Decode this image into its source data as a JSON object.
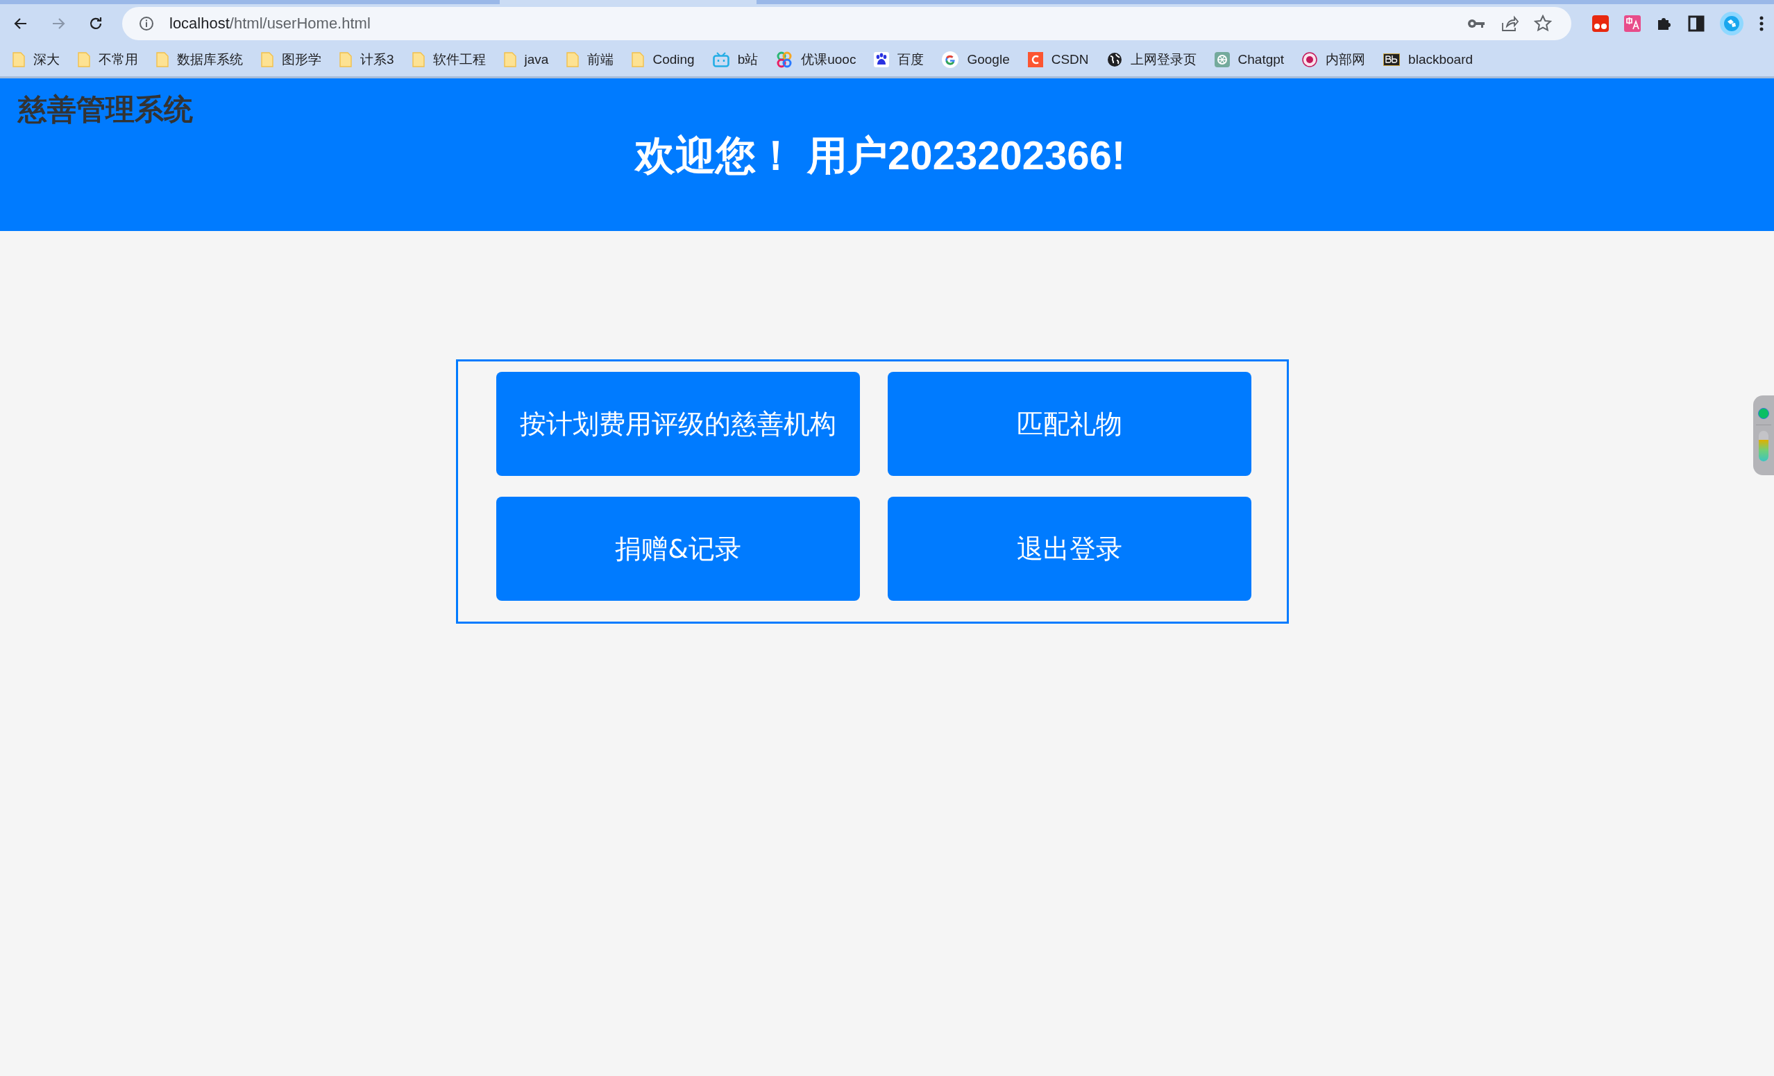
{
  "browser": {
    "nav": [
      {
        "kind": "back",
        "disabled": false
      },
      {
        "kind": "forward",
        "disabled": true
      },
      {
        "kind": "reload",
        "disabled": false
      }
    ],
    "url_host": "localhost",
    "url_path": "/html/userHome.html",
    "bookmarks": [
      {
        "label": "深大",
        "kind": "folder"
      },
      {
        "label": "不常用",
        "kind": "folder"
      },
      {
        "label": "数据库系统",
        "kind": "folder"
      },
      {
        "label": "图形学",
        "kind": "folder"
      },
      {
        "label": "计系3",
        "kind": "folder"
      },
      {
        "label": "软件工程",
        "kind": "folder"
      },
      {
        "label": "java",
        "kind": "folder"
      },
      {
        "label": "前端",
        "kind": "folder"
      },
      {
        "label": "Coding",
        "kind": "folder"
      },
      {
        "label": "b站",
        "kind": "tv"
      },
      {
        "label": "优课uooc",
        "kind": "rings"
      },
      {
        "label": "百度",
        "kind": "paw"
      },
      {
        "label": "Google",
        "kind": "g"
      },
      {
        "label": "CSDN",
        "kind": "c"
      },
      {
        "label": "上网登录页",
        "kind": "globe"
      },
      {
        "label": "Chatgpt",
        "kind": "knot"
      },
      {
        "label": "内部网",
        "kind": "seal"
      },
      {
        "label": "blackboard",
        "kind": "bb"
      }
    ]
  },
  "header": {
    "brand": "慈善管理系统",
    "welcome": "欢迎您！ 用户2023202366!"
  },
  "menu": {
    "buttons": [
      "按计划费用评级的慈善机构",
      "匹配礼物",
      "捐赠&记录",
      "退出登录"
    ]
  }
}
